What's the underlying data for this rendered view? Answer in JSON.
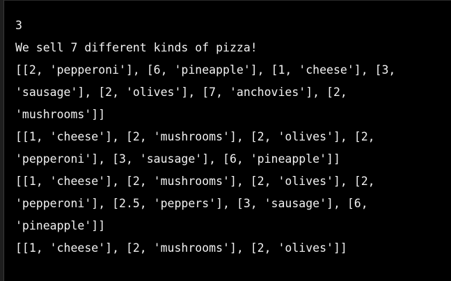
{
  "terminal": {
    "text_color": "#f2f2f2",
    "background_color": "#000000",
    "lines": [
      "3",
      "We sell 7 different kinds of pizza!",
      "[[2, 'pepperoni'], [6, 'pineapple'], [1, 'cheese'], [3,",
      "'sausage'], [2, 'olives'], [7, 'anchovies'], [2,",
      "'mushrooms']]",
      "[[1, 'cheese'], [2, 'mushrooms'], [2, 'olives'], [2,",
      "'pepperoni'], [3, 'sausage'], [6, 'pineapple']]",
      "[[1, 'cheese'], [2, 'mushrooms'], [2, 'olives'], [2,",
      "'pepperoni'], [2.5, 'peppers'], [3, 'sausage'], [6,",
      "'pineapple']]",
      "[[1, 'cheese'], [2, 'mushrooms'], [2, 'olives']]"
    ]
  }
}
